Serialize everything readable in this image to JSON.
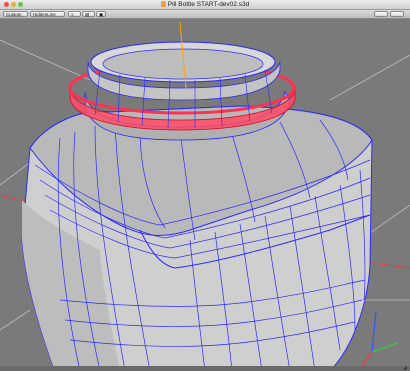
{
  "window": {
    "title": "Pill Bottle START-dev02.s3d"
  },
  "toolbar": {
    "view_label": "Custom",
    "mode_label": "HiddenLine",
    "btn_a_label": "≡",
    "btn_b_label": "▤",
    "btn_c_label": "▣"
  },
  "icons": {
    "close": "close-icon",
    "minimize": "minimize-icon",
    "zoom": "zoom-icon",
    "resize": "resize-grip-icon",
    "axis": "axis-triad-icon"
  },
  "colors": {
    "background": "#7a7a7a",
    "mesh_line": "#2a2aff",
    "highlight_ring": "#ff4a64",
    "pivot_line": "#ffa200",
    "body_fill": "#c8c8c8",
    "axis_x": "#ff3030",
    "axis_y": "#30d040",
    "axis_z": "#3050ff"
  }
}
